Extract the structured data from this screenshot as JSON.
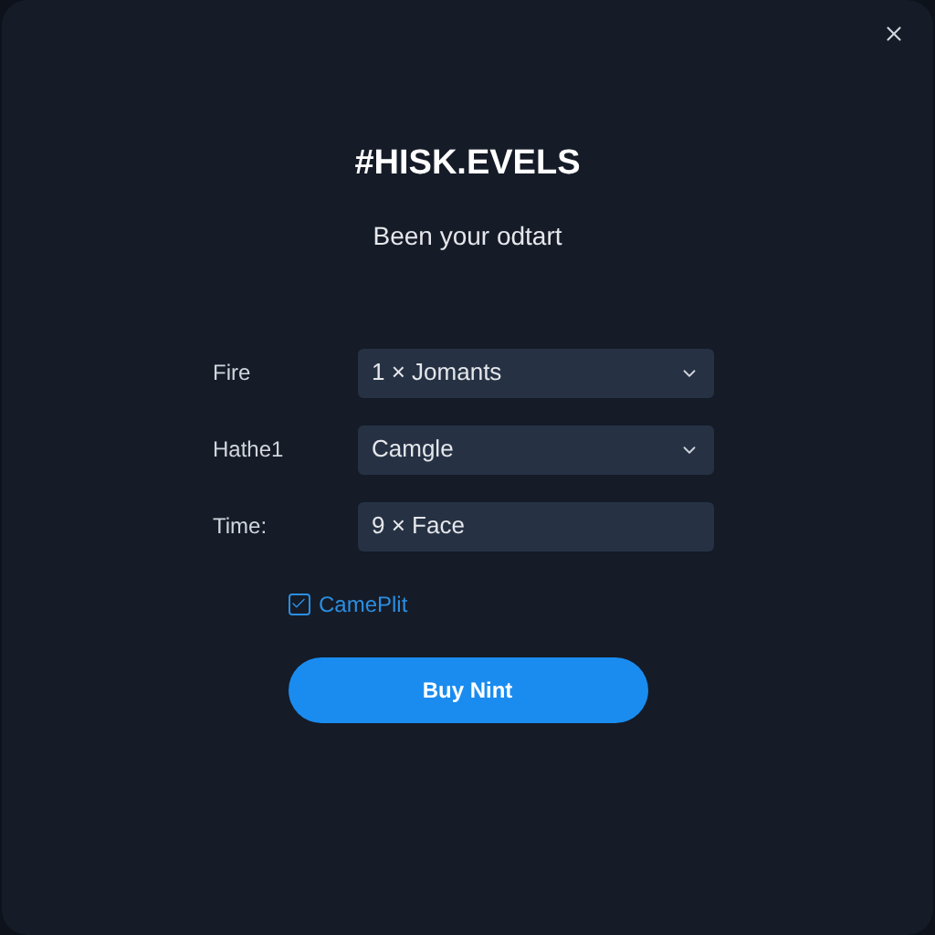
{
  "dialog": {
    "title": "#HISK.EVELS",
    "subtitle": "Been your odtart"
  },
  "fields": [
    {
      "label": "Fire",
      "kind": "select",
      "value": "1 × Jomants"
    },
    {
      "label": "Hathe1",
      "kind": "select",
      "value": "Camgle"
    },
    {
      "label": "Time:",
      "kind": "text",
      "value": "9 × Face"
    }
  ],
  "checkbox": {
    "label": "CamePlit",
    "checked": true
  },
  "button": {
    "label": "Buy Nint"
  }
}
